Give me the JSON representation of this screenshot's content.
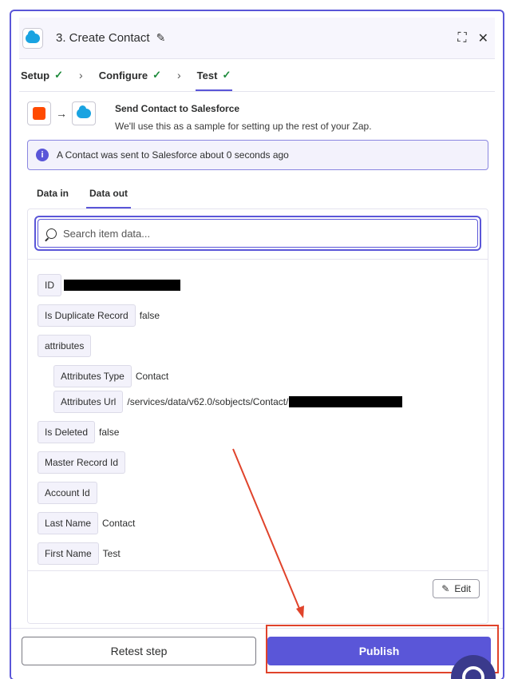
{
  "header": {
    "step_title": "3. Create Contact",
    "icons": [
      "salesforce-logo-icon",
      "pencil-icon",
      "expand-icon",
      "close-icon"
    ]
  },
  "steps": [
    {
      "label": "Setup",
      "done": true
    },
    {
      "label": "Configure",
      "done": true
    },
    {
      "label": "Test",
      "done": true,
      "active": true
    }
  ],
  "summary": {
    "title": "Send Contact to Salesforce",
    "subtitle": "We'll use this as a sample for setting up the rest of your Zap."
  },
  "alert": {
    "text": "A Contact was sent to Salesforce about 0 seconds ago"
  },
  "tabs": [
    {
      "label": "Data in",
      "active": false
    },
    {
      "label": "Data out",
      "active": true
    }
  ],
  "search": {
    "placeholder": "Search item data..."
  },
  "fields": [
    {
      "key": "ID",
      "value": "",
      "redacted": true
    },
    {
      "key": "Is Duplicate Record",
      "value": "false"
    },
    {
      "key": "attributes",
      "value": ""
    },
    {
      "key": "Attributes Type",
      "value": "Contact"
    },
    {
      "key": "Attributes Url",
      "value": "/services/data/v62.0/sobjects/Contact/",
      "redacted": true
    },
    {
      "key": "Is Deleted",
      "value": "false"
    },
    {
      "key": "Master Record Id",
      "value": ""
    },
    {
      "key": "Account Id",
      "value": ""
    },
    {
      "key": "Last Name",
      "value": "Contact"
    },
    {
      "key": "First Name",
      "value": "Test"
    }
  ],
  "actions": {
    "edit_label": "Edit",
    "retest_label": "Retest step",
    "publish_label": "Publish"
  },
  "colors": {
    "accent": "#5a56d8",
    "annotation": "#e0432b",
    "zapier_orange": "#ff4a00",
    "salesforce_blue": "#19a3e1"
  }
}
